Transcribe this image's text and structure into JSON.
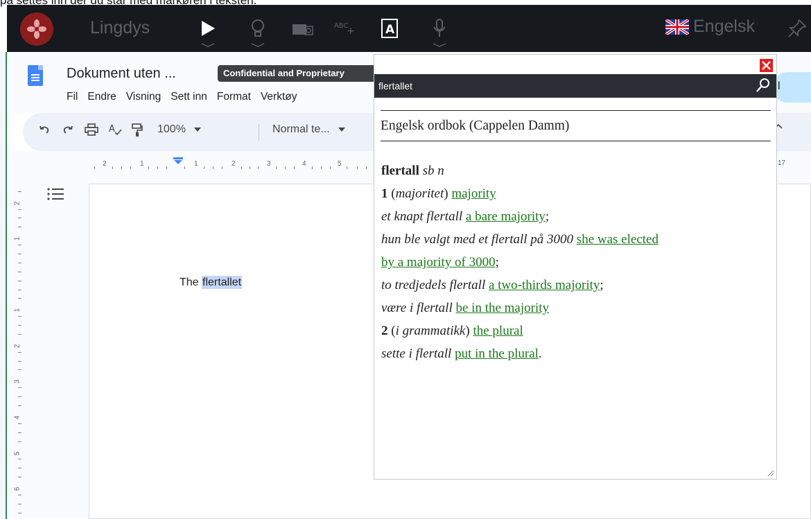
{
  "caption": "på settes inn der du står med markøren i teksten.",
  "lingdys": {
    "title": "Lingdys",
    "language": "Engelsk",
    "icons": [
      "play-icon",
      "lightbulb-icon",
      "camera-icon",
      "abc-spell-icon",
      "dictionary-icon",
      "microphone-icon",
      "pin-icon"
    ]
  },
  "docs": {
    "title": "Dokument uten ...",
    "badge": "Confidential and Proprietary",
    "menu": [
      "Fil",
      "Endre",
      "Visning",
      "Sett inn",
      "Format",
      "Verktøy"
    ],
    "share_label": "l",
    "zoom": "100%",
    "style": "Normal te...",
    "ruler_labels": [
      "2",
      "1",
      "1",
      "2",
      "3",
      "4",
      "5"
    ],
    "ruler_right": "17",
    "vruler_labels": [
      "2",
      "1",
      "1",
      "2",
      "3",
      "4",
      "5",
      "6"
    ],
    "doc_text_plain": "The ",
    "doc_text_selected": "flertallet"
  },
  "dict": {
    "query": "flertallet",
    "source": "Engelsk ordbok (Cappelen Damm)",
    "headword": "flertall",
    "pos": "sb n",
    "sense1_num": "1",
    "sense1_label": "majoritet",
    "sense1_trans": "majority",
    "ex1_no": "et knapt flertall",
    "ex1_en": "a bare majority",
    "ex2_no": "hun ble valgt med et flertall på 3000",
    "ex2_en_a": "she was elected",
    "ex2_en_b": "by a majority of 3000",
    "ex3_no": "to tredjedels flertall",
    "ex3_en": "a two-thirds majority",
    "ex4_no": "være i flertall",
    "ex4_en": "be in the majority",
    "sense2_num": "2",
    "sense2_label": "i grammatikk",
    "sense2_trans": "the plural",
    "ex5_no": "sette i flertall",
    "ex5_en": "put in the plural"
  },
  "colors": {
    "lingdys_bar": "#16191d",
    "link_green": "#1a7a1a",
    "close_red": "#e32020",
    "selection": "#c5d7f5"
  }
}
